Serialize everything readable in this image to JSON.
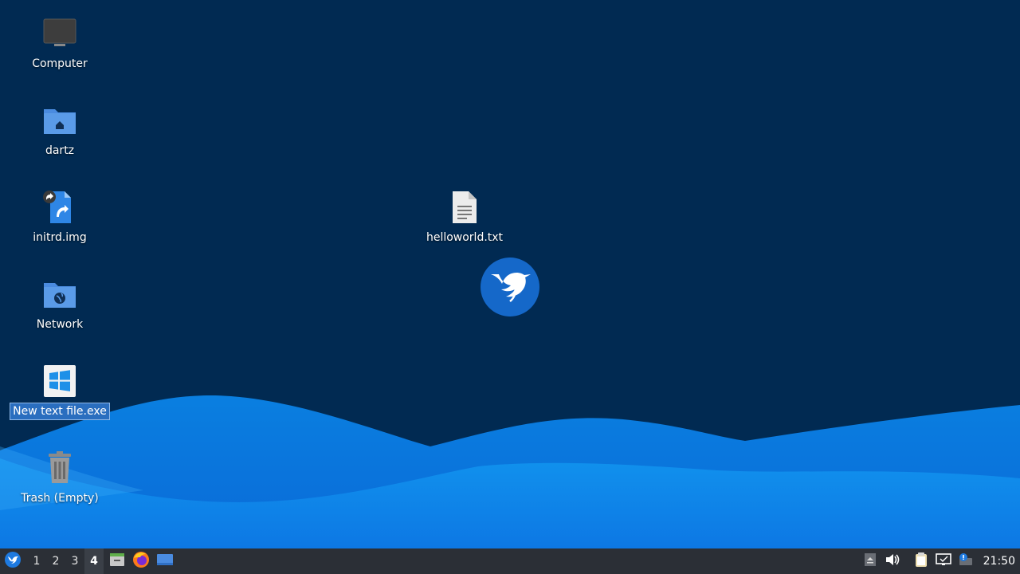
{
  "desktop": {
    "background_color": "#012a52",
    "icons": [
      {
        "label": "Computer",
        "icon": "computer-icon"
      },
      {
        "label": "dartz",
        "icon": "home-folder-icon"
      },
      {
        "label": "initrd.img",
        "icon": "symlink-file-icon"
      },
      {
        "label": "Network",
        "icon": "network-folder-icon"
      },
      {
        "label": "New text file.exe",
        "icon": "windows-exe-icon",
        "selected": true
      },
      {
        "label": "Trash (Empty)",
        "icon": "trash-icon"
      },
      {
        "label": "helloworld.txt",
        "icon": "text-file-icon"
      }
    ],
    "center_logo": "hummingbird-logo-icon"
  },
  "panel": {
    "menu_icon": "whisker-menu-icon",
    "workspaces": [
      "1",
      "2",
      "3",
      "4"
    ],
    "active_workspace": "4",
    "launchers": [
      "file-manager-icon",
      "firefox-icon",
      "show-desktop-icon"
    ],
    "tray": [
      "tray-expand-icon",
      "volume-icon",
      "clipboard-icon",
      "network-icon",
      "notification-icon"
    ],
    "clock": "21:50"
  }
}
